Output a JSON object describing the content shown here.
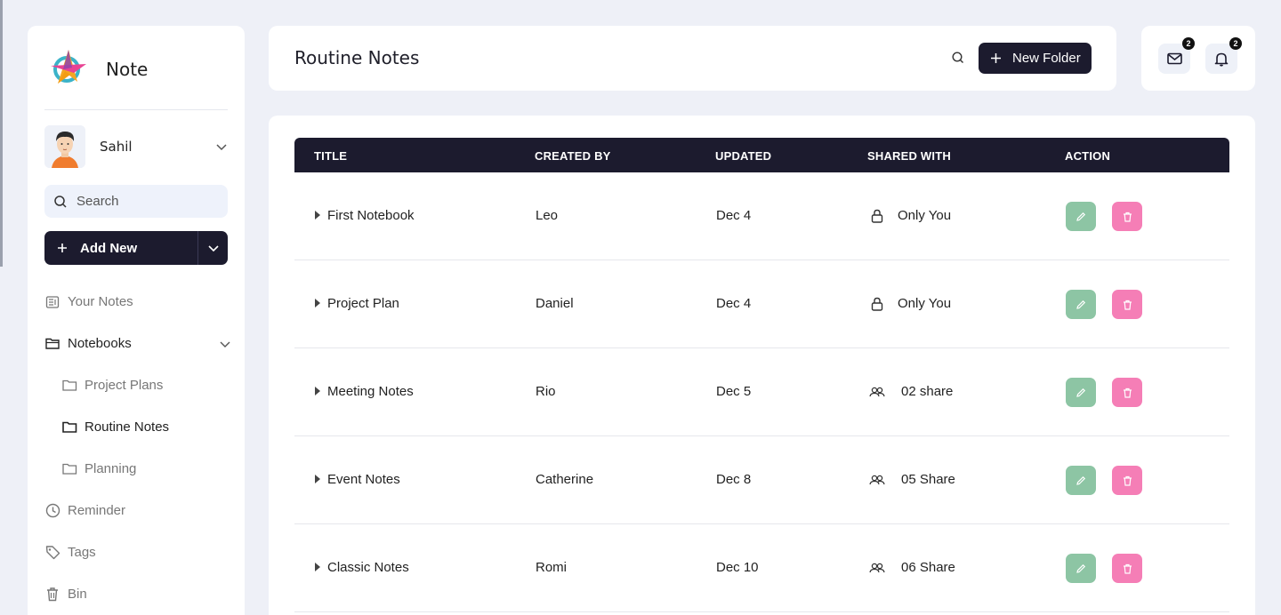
{
  "app": {
    "brand": "Note"
  },
  "user": {
    "name": "Sahil"
  },
  "sidebar": {
    "search_placeholder": "Search",
    "add_new_label": "Add New",
    "items": [
      {
        "label": "Your Notes",
        "icon": "notes-icon"
      },
      {
        "label": "Notebooks",
        "icon": "folder-open-icon"
      },
      {
        "label": "Project Plans",
        "icon": "folder-icon"
      },
      {
        "label": "Routine Notes",
        "icon": "folder-icon"
      },
      {
        "label": "Planning",
        "icon": "folder-icon"
      },
      {
        "label": "Reminder",
        "icon": "clock-icon"
      },
      {
        "label": "Tags",
        "icon": "tag-icon"
      },
      {
        "label": "Bin",
        "icon": "trash-icon"
      }
    ]
  },
  "header": {
    "title": "Routine Notes",
    "new_folder_label": "New Folder",
    "mail_count": "2",
    "notification_count": "2"
  },
  "table": {
    "columns": [
      "TITLE",
      "CREATED BY",
      "UPDATED",
      "SHARED WITH",
      "ACTION"
    ],
    "rows": [
      {
        "title": "First Notebook",
        "created_by": "Leo",
        "updated": "Dec 4",
        "shared": "Only You",
        "shared_icon": "lock-icon"
      },
      {
        "title": "Project Plan",
        "created_by": "Daniel",
        "updated": "Dec 4",
        "shared": "Only You",
        "shared_icon": "lock-icon"
      },
      {
        "title": "Meeting Notes",
        "created_by": "Rio",
        "updated": "Dec 5",
        "shared": "02 share",
        "shared_icon": "users-icon"
      },
      {
        "title": "Event Notes",
        "created_by": "Catherine",
        "updated": "Dec 8",
        "shared": "05 Share",
        "shared_icon": "users-icon"
      },
      {
        "title": "Classic Notes",
        "created_by": "Romi",
        "updated": "Dec 10",
        "shared": "06 Share",
        "shared_icon": "users-icon"
      }
    ]
  },
  "colors": {
    "primary": "#1c1b2e",
    "edit": "#8dc5a4",
    "delete": "#f57eb6",
    "background": "#eef0f7"
  }
}
